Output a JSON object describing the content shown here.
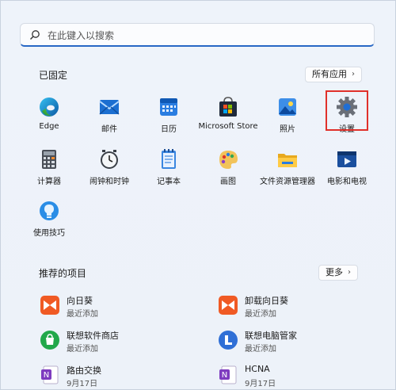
{
  "search": {
    "placeholder": "在此键入以搜索"
  },
  "pinned": {
    "title": "已固定",
    "all_apps": "所有应用",
    "apps": [
      {
        "label": "Edge",
        "icon": "edge-icon"
      },
      {
        "label": "邮件",
        "icon": "mail-icon"
      },
      {
        "label": "日历",
        "icon": "calendar-icon"
      },
      {
        "label": "Microsoft Store",
        "icon": "store-icon"
      },
      {
        "label": "照片",
        "icon": "photos-icon"
      },
      {
        "label": "设置",
        "icon": "settings-gear-icon"
      },
      {
        "label": "计算器",
        "icon": "calculator-icon"
      },
      {
        "label": "闹钟和时钟",
        "icon": "clock-icon"
      },
      {
        "label": "记事本",
        "icon": "notepad-icon"
      },
      {
        "label": "画图",
        "icon": "paint-icon"
      },
      {
        "label": "文件资源管理器",
        "icon": "folder-icon"
      },
      {
        "label": "电影和电视",
        "icon": "movies-icon"
      },
      {
        "label": "使用技巧",
        "icon": "tips-icon"
      }
    ]
  },
  "recommended": {
    "title": "推荐的项目",
    "more": "更多",
    "items": [
      {
        "name": "向日葵",
        "sub": "最近添加",
        "icon": "sunflower-icon"
      },
      {
        "name": "卸载向日葵",
        "sub": "最近添加",
        "icon": "sunflower-icon"
      },
      {
        "name": "联想软件商店",
        "sub": "最近添加",
        "icon": "lenovo-store-icon"
      },
      {
        "name": "联想电脑管家",
        "sub": "最近添加",
        "icon": "lenovo-manager-icon"
      },
      {
        "name": "路由交换",
        "sub": "9月17日",
        "icon": "onenote-icon"
      },
      {
        "name": "HCNA",
        "sub": "9月17日",
        "icon": "onenote-icon"
      }
    ]
  },
  "colors": {
    "accent": "#2767c5",
    "highlight": "#e0302a"
  }
}
